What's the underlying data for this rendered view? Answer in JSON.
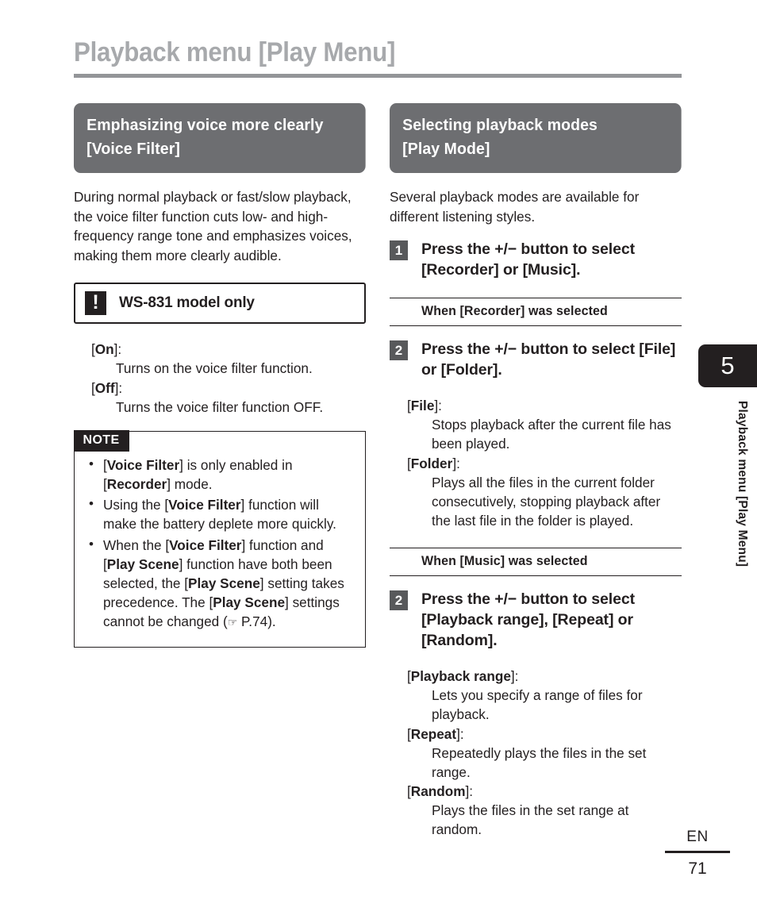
{
  "page": {
    "title": "Playback menu [Play Menu]",
    "chapter_number": "5",
    "chapter_vertical_label": "Playback menu [Play Menu]",
    "footer_language": "EN",
    "footer_page_number": "71",
    "colors": {
      "title_gray": "#a7a9ac",
      "rule_gray": "#939598",
      "header_pill_gray": "#6d6e71",
      "step_number_gray": "#58595b",
      "ink_black": "#231f20"
    }
  },
  "left_column": {
    "header": {
      "line1": "Emphasizing voice more clearly",
      "line2": "[Voice Filter]"
    },
    "intro": "During normal playback or fast/slow playback, the voice filter function cuts low- and high-frequency range tone and emphasizes voices, making them more clearly audible.",
    "caution": {
      "icon": "exclamation-mark",
      "text": "WS-831 model only"
    },
    "settings": [
      {
        "term_open": "[",
        "term_bold": "On",
        "term_close": "]:",
        "desc": "Turns on the voice filter function."
      },
      {
        "term_open": "[",
        "term_bold": "Off",
        "term_close": "]:",
        "desc": "Turns the voice filter function OFF."
      }
    ],
    "note": {
      "label": "NOTE",
      "items": [
        {
          "parts": [
            {
              "t": "[",
              "b": false
            },
            {
              "t": "Voice Filter",
              "b": true
            },
            {
              "t": "] is only enabled in [",
              "b": false
            },
            {
              "t": "Recorder",
              "b": true
            },
            {
              "t": "] mode.",
              "b": false
            }
          ]
        },
        {
          "parts": [
            {
              "t": "Using the [",
              "b": false
            },
            {
              "t": "Voice Filter",
              "b": true
            },
            {
              "t": "] function will make the battery deplete more quickly.",
              "b": false
            }
          ]
        },
        {
          "parts": [
            {
              "t": "When the [",
              "b": false
            },
            {
              "t": "Voice Filter",
              "b": true
            },
            {
              "t": "] function and [",
              "b": false
            },
            {
              "t": "Play Scene",
              "b": true
            },
            {
              "t": "] function have both been selected, the [",
              "b": false
            },
            {
              "t": "Play Scene",
              "b": true
            },
            {
              "t": "] setting takes precedence. The [",
              "b": false
            },
            {
              "t": "Play Scene",
              "b": true
            },
            {
              "t": "] settings cannot be changed (",
              "b": false
            },
            {
              "t": "☞",
              "b": false,
              "hand": true
            },
            {
              "t": " P.74).",
              "b": false
            }
          ]
        }
      ]
    }
  },
  "right_column": {
    "header": {
      "line1": "Selecting playback modes",
      "line2": "[Play Mode]"
    },
    "intro": "Several playback modes are available for different listening styles.",
    "step1": {
      "number": "1",
      "parts": [
        {
          "t": "Press the +/− button to select [",
          "b": false
        },
        {
          "t": "Recorder",
          "b": true
        },
        {
          "t": "] or [",
          "b": false
        },
        {
          "t": "Music",
          "b": true
        },
        {
          "t": "].",
          "b": false
        }
      ]
    },
    "recorder_section": {
      "band_parts": [
        {
          "t": "When [",
          "b": false
        },
        {
          "t": "Recorder",
          "b": true
        },
        {
          "t": "] was selected",
          "b": false
        }
      ],
      "step": {
        "number": "2",
        "parts": [
          {
            "t": "Press the +/− button to select [",
            "b": false
          },
          {
            "t": "File",
            "b": true
          },
          {
            "t": "] or [",
            "b": false
          },
          {
            "t": "Folder",
            "b": true
          },
          {
            "t": "].",
            "b": false
          }
        ]
      },
      "settings": [
        {
          "term_open": "[",
          "term_bold": "File",
          "term_close": "]:",
          "desc": "Stops playback after the current file has been played."
        },
        {
          "term_open": "[",
          "term_bold": "Folder",
          "term_close": "]:",
          "desc": "Plays all the files in the current folder consecutively, stopping playback after the last file in the folder is played."
        }
      ]
    },
    "music_section": {
      "band_parts": [
        {
          "t": "When [",
          "b": false
        },
        {
          "t": "Music",
          "b": true
        },
        {
          "t": "] was selected",
          "b": false
        }
      ],
      "step": {
        "number": "2",
        "parts": [
          {
            "t": "Press the +/− button to select [",
            "b": false
          },
          {
            "t": "Playback range",
            "b": true
          },
          {
            "t": "], [",
            "b": false
          },
          {
            "t": "Repeat",
            "b": true
          },
          {
            "t": "] or [",
            "b": false
          },
          {
            "t": "Random",
            "b": true
          },
          {
            "t": "].",
            "b": false
          }
        ]
      },
      "settings": [
        {
          "term_open": "[",
          "term_bold": "Playback range",
          "term_close": "]:",
          "desc": "Lets you specify a range of files for playback."
        },
        {
          "term_open": "[",
          "term_bold": "Repeat",
          "term_close": "]:",
          "desc": "Repeatedly plays the files in the set range."
        },
        {
          "term_open": "[",
          "term_bold": "Random",
          "term_close": "]:",
          "desc": "Plays the files in the set range at random."
        }
      ]
    }
  }
}
